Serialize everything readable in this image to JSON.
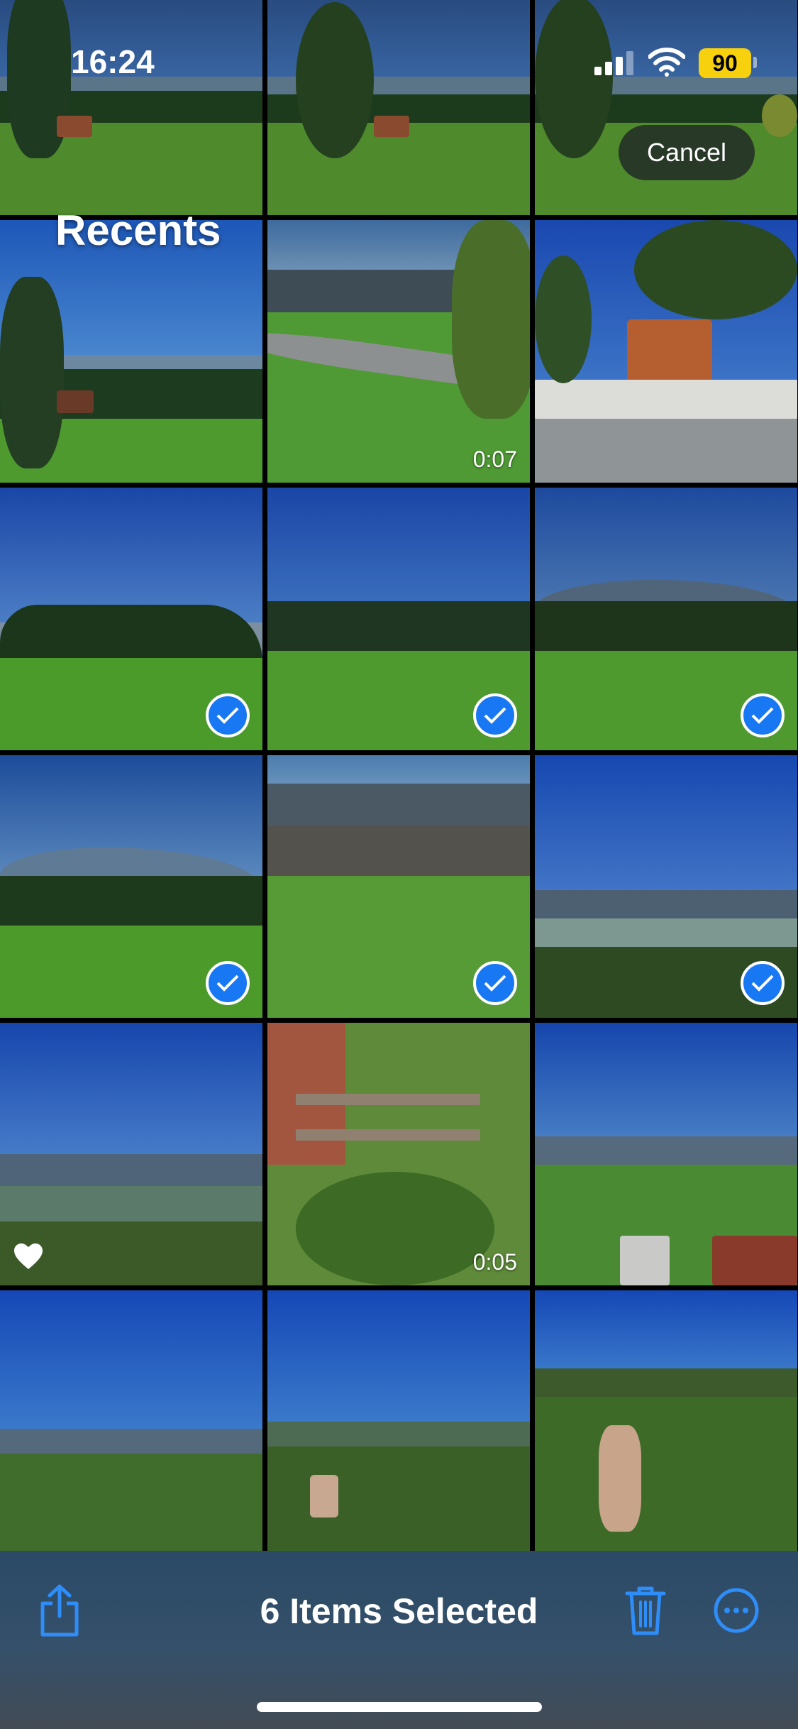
{
  "status_bar": {
    "time": "16:24",
    "battery": "90"
  },
  "header": {
    "title": "Recents",
    "cancel_label": "Cancel"
  },
  "grid": {
    "tiles": [
      {
        "selected": false,
        "duration": "",
        "favorite": false
      },
      {
        "selected": false,
        "duration": "",
        "favorite": false
      },
      {
        "selected": false,
        "duration": "",
        "favorite": false
      },
      {
        "selected": false,
        "duration": "",
        "favorite": false
      },
      {
        "selected": false,
        "duration": "0:07",
        "favorite": false
      },
      {
        "selected": false,
        "duration": "",
        "favorite": false
      },
      {
        "selected": true,
        "duration": "",
        "favorite": false
      },
      {
        "selected": true,
        "duration": "",
        "favorite": false
      },
      {
        "selected": true,
        "duration": "",
        "favorite": false
      },
      {
        "selected": true,
        "duration": "",
        "favorite": false
      },
      {
        "selected": true,
        "duration": "",
        "favorite": false
      },
      {
        "selected": true,
        "duration": "",
        "favorite": false
      },
      {
        "selected": false,
        "duration": "",
        "favorite": true
      },
      {
        "selected": false,
        "duration": "0:05",
        "favorite": false
      },
      {
        "selected": false,
        "duration": "",
        "favorite": false
      },
      {
        "selected": false,
        "duration": "",
        "favorite": false
      },
      {
        "selected": false,
        "duration": "",
        "favorite": false
      },
      {
        "selected": false,
        "duration": "",
        "favorite": false
      }
    ]
  },
  "toolbar": {
    "selection_label": "6 Items Selected",
    "share_icon": "share-icon",
    "trash_icon": "trash-icon",
    "more_icon": "more-icon"
  },
  "colors": {
    "accent": "#1877f2",
    "battery": "#f7d10e"
  }
}
